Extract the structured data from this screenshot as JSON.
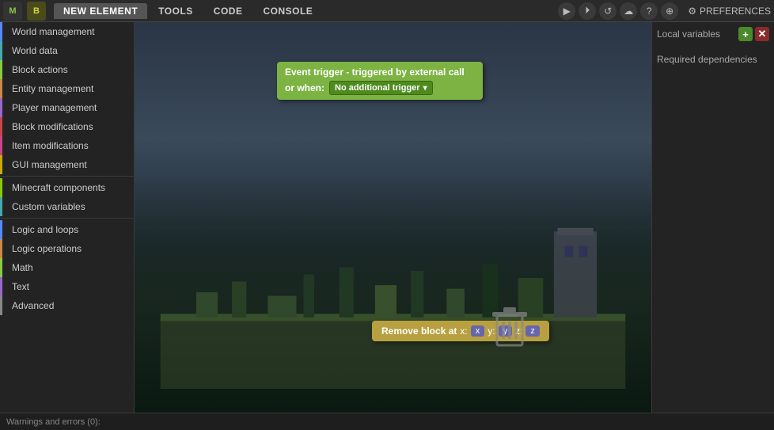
{
  "topbar": {
    "logo1": "M",
    "logo2": "B",
    "tabs": [
      {
        "label": "NEW ELEMENT",
        "active": true
      },
      {
        "label": "TOOLS",
        "active": false
      },
      {
        "label": "CODE",
        "active": false
      },
      {
        "label": "CONSOLE",
        "active": false
      }
    ],
    "icons": [
      "▶",
      "⏵",
      "↺",
      "☁",
      "?",
      "⊕"
    ],
    "prefs_label": "PREFERENCES",
    "prefs_icon": "⚙"
  },
  "sidebar": {
    "items": [
      {
        "label": "World management",
        "highlight": "blue"
      },
      {
        "label": "World data",
        "highlight": "teal"
      },
      {
        "label": "Block actions",
        "highlight": "green"
      },
      {
        "label": "Entity management",
        "highlight": "orange"
      },
      {
        "label": "Player management",
        "highlight": "purple"
      },
      {
        "label": "Block modifications",
        "highlight": "red"
      },
      {
        "label": "Item modifications",
        "highlight": "pink"
      },
      {
        "label": "GUI management",
        "highlight": "yellow"
      },
      {
        "label": "Minecraft components",
        "highlight": "lime"
      },
      {
        "label": "Custom variables",
        "highlight": "teal"
      },
      {
        "label": "Logic and loops",
        "highlight": "blue"
      },
      {
        "label": "Logic operations",
        "highlight": "orange"
      },
      {
        "label": "Math",
        "highlight": "green"
      },
      {
        "label": "Text",
        "highlight": "purple"
      },
      {
        "label": "Advanced",
        "highlight": "gray"
      }
    ]
  },
  "canvas": {
    "event_trigger": {
      "line1": "Event trigger - triggered by external call",
      "line2_prefix": "or when:",
      "dropdown_label": "No additional trigger"
    },
    "remove_block": {
      "prefix": "Remove block at",
      "x_label": "x:",
      "x_badge": "x",
      "y_label": "y:",
      "y_badge": "y",
      "z_label": "z:",
      "z_badge": "z"
    }
  },
  "right_panel": {
    "local_vars_label": "Local variables",
    "add_btn": "+",
    "remove_btn": "✕",
    "required_deps_label": "Required dependencies"
  },
  "bottom_bar": {
    "warnings_label": "Warnings and errors (0):"
  }
}
